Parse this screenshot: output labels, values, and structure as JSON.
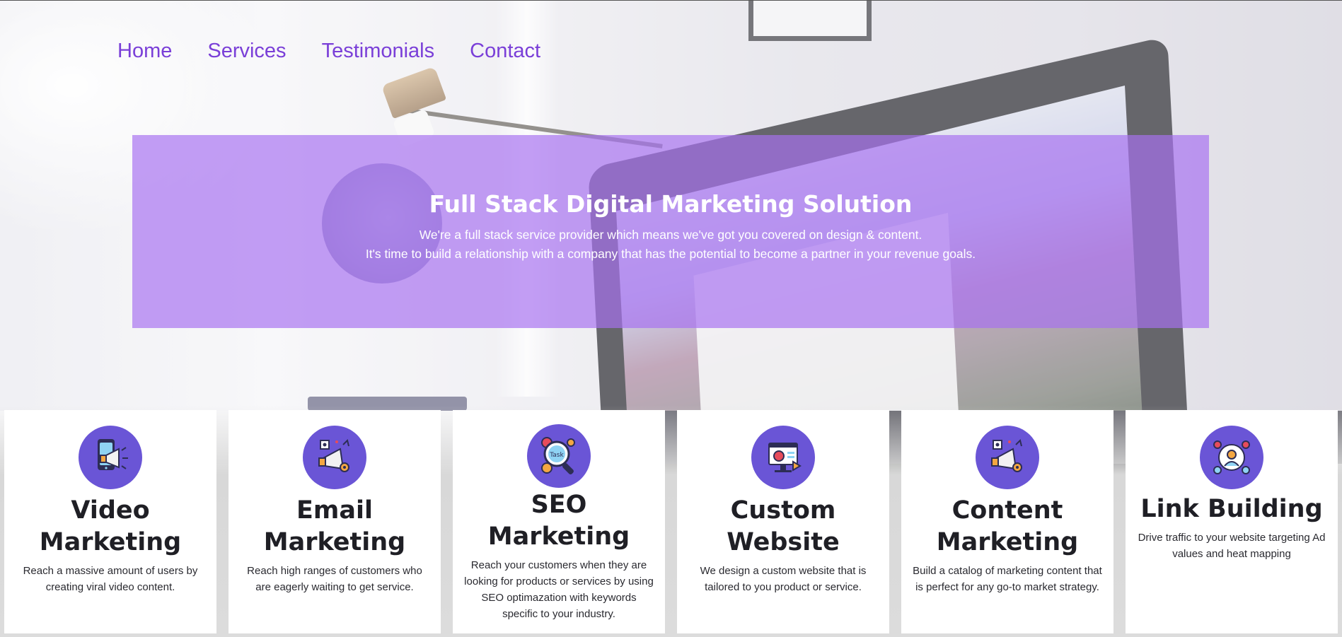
{
  "nav": {
    "items": [
      {
        "label": "Home"
      },
      {
        "label": "Services"
      },
      {
        "label": "Testimonials"
      },
      {
        "label": "Contact"
      }
    ]
  },
  "hero": {
    "title": "Full Stack Digital Marketing Solution",
    "line1": "We're a full stack service provider which means we've got you covered on design & content.",
    "line2": "It's time to build a relationship with a company that has the potential to become a partner in your revenue goals."
  },
  "services": [
    {
      "title": "Video Marketing",
      "description": "Reach a massive amount of users by creating viral video content.",
      "icon": "video-marketing-icon"
    },
    {
      "title": "Email Marketing",
      "description": "Reach high ranges of customers who are eagerly waiting to get service.",
      "icon": "email-marketing-icon"
    },
    {
      "title": "SEO Marketing",
      "description": "Reach your customers when they are looking for products or services by using SEO optimazation with keywords specific to your industry.",
      "icon": "seo-task-icon",
      "icon_text": "Task"
    },
    {
      "title": "Custom Website",
      "description": "We design a custom website that is tailored to you product or service.",
      "icon": "custom-website-icon"
    },
    {
      "title": "Content Marketing",
      "description": "Build a catalog of marketing content that is perfect for any go-to market strategy.",
      "icon": "content-marketing-icon"
    },
    {
      "title": "Link Building",
      "description": "Drive traffic to your website targeting Ad values and heat mapping",
      "icon": "link-building-icon"
    }
  ],
  "colors": {
    "accent": "#7a3fd8",
    "hero_panel": "#a670f0",
    "icon_circle": "#6a55d6"
  }
}
